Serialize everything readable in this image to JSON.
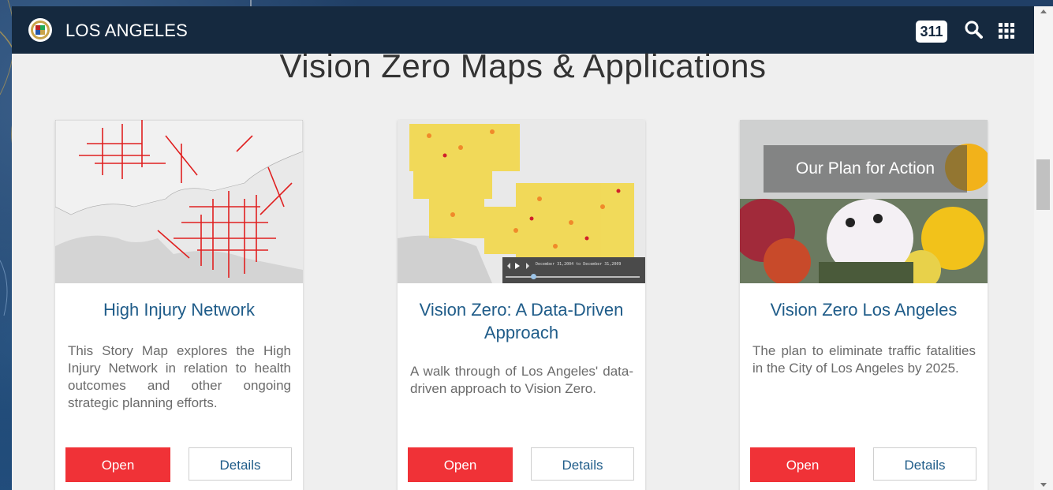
{
  "header": {
    "brand": "LOS ANGELES",
    "badge_311": "311",
    "icons": [
      "la-seal-icon",
      "search-icon",
      "apps-grid-icon"
    ]
  },
  "page": {
    "title": "Vision Zero Maps & Applications"
  },
  "cards": [
    {
      "title": "High Injury Network",
      "description": "This Story Map explores the High Injury Network in relation to health outcomes and other ongoing strategic planning efforts.",
      "open_label": "Open",
      "details_label": "Details"
    },
    {
      "title": "Vision Zero: A Data-Driven Approach",
      "description": "A walk through of Los Angeles' data-driven approach to Vision Zero.",
      "open_label": "Open",
      "details_label": "Details",
      "player_text": "December 31,2004 to December 31,2009"
    },
    {
      "title": "Vision Zero Los Angeles",
      "description": "The plan to eliminate traffic fatalities in the City of Los Angeles by 2025.",
      "open_label": "Open",
      "details_label": "Details",
      "image_overlay": "Our Plan for Action"
    }
  ],
  "colors": {
    "header_bg": "#15293f",
    "open_button": "#f03237",
    "title_blue": "#1f5c89"
  }
}
